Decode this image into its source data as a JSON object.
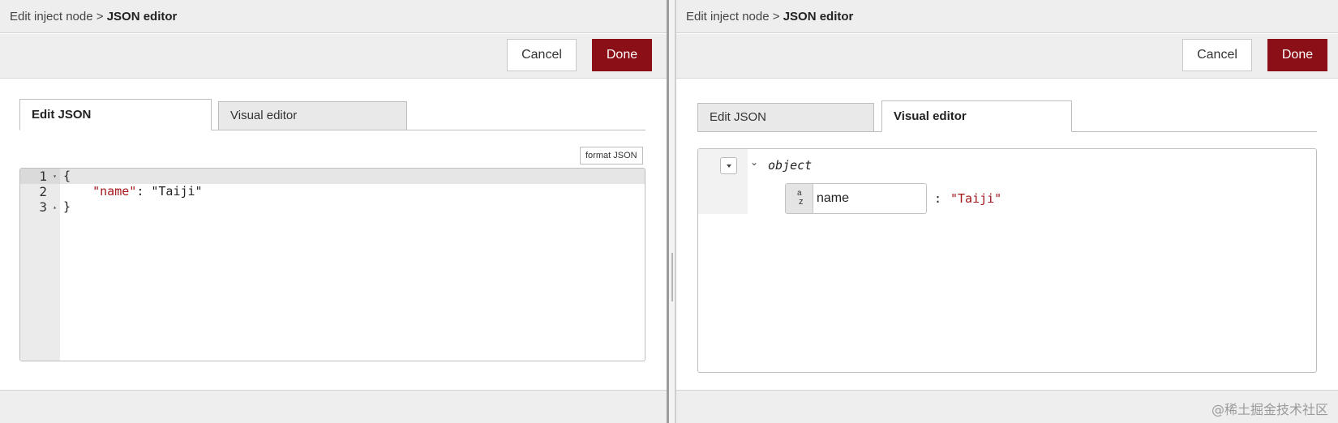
{
  "left_panel": {
    "breadcrumb": {
      "parent": "Edit inject node",
      "separator": ">",
      "current": "JSON editor"
    },
    "toolbar": {
      "cancel_label": "Cancel",
      "done_label": "Done"
    },
    "tabs": [
      {
        "label": "Edit JSON",
        "active": true
      },
      {
        "label": "Visual editor",
        "active": false
      }
    ],
    "format_button_label": "format JSON",
    "code_lines": [
      {
        "number": "1",
        "fold": "▾",
        "text": "{"
      },
      {
        "number": "2",
        "fold": "",
        "key": "\"name\"",
        "sep": ": ",
        "value": "\"Taiji\""
      },
      {
        "number": "3",
        "fold": "▴",
        "text": "}"
      }
    ]
  },
  "right_panel": {
    "breadcrumb": {
      "parent": "Edit inject node",
      "separator": ">",
      "current": "JSON editor"
    },
    "toolbar": {
      "cancel_label": "Cancel",
      "done_label": "Done"
    },
    "tabs": [
      {
        "label": "Edit JSON",
        "active": false
      },
      {
        "label": "Visual editor",
        "active": true
      }
    ],
    "tree": {
      "expand_glyph": "⌄",
      "type_label": "object",
      "entries": [
        {
          "key_type_top": "a",
          "key_type_bottom": "z",
          "key": "name",
          "colon": ":",
          "value": "\"Taiji\""
        }
      ]
    }
  },
  "watermark": "@稀土掘金技术社区",
  "colors": {
    "primary_button": "#8b0f16",
    "json_key": "#a4171c",
    "json_string": "#a4171c"
  }
}
